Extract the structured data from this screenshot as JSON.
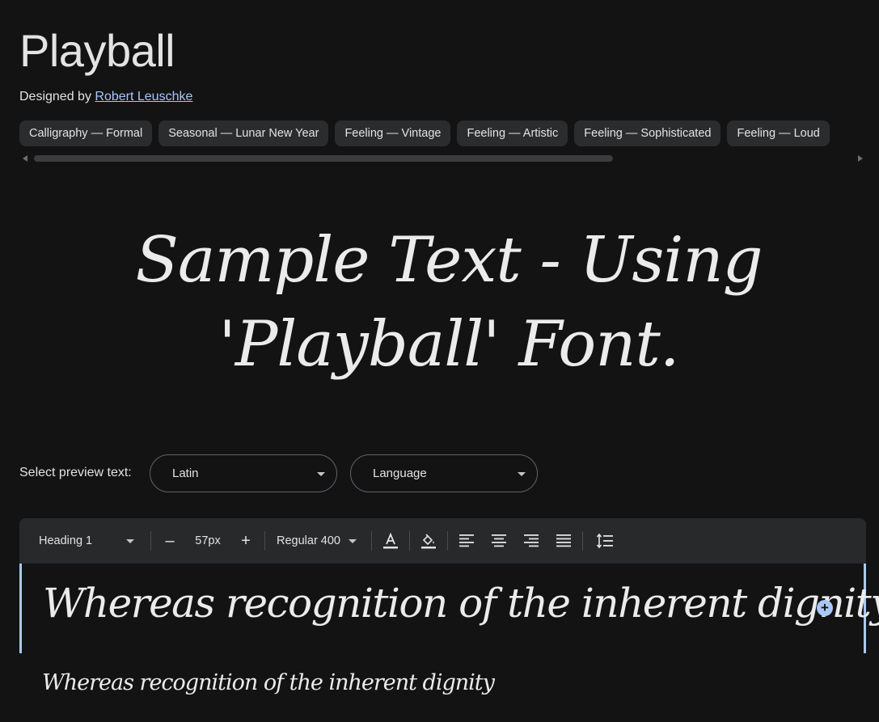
{
  "font": {
    "name": "Playball",
    "designed_by_label": "Designed by",
    "designer": "Robert Leuschke"
  },
  "tags": [
    "Calligraphy — Formal",
    "Seasonal — Lunar New Year",
    "Feeling — Vintage",
    "Feeling — Artistic",
    "Feeling — Sophisticated",
    "Feeling — Loud"
  ],
  "hero_text": "Sample Text - Using 'Playball' Font.",
  "preview_controls": {
    "label": "Select preview text:",
    "script_select": "Latin",
    "language_select": "Language"
  },
  "toolbar": {
    "style": "Heading 1",
    "decrease": "–",
    "size": "57px",
    "increase": "+",
    "weight": "Regular 400"
  },
  "preview": {
    "sample_large": "Whereas recognition of the inherent dignity",
    "sample_small": "Whereas recognition of the inherent dignity",
    "add_symbol": "+"
  },
  "colors": {
    "background": "#131314",
    "accent": "#a8c7fa",
    "chip": "#2b2c2e",
    "toolbar": "#28292a"
  }
}
